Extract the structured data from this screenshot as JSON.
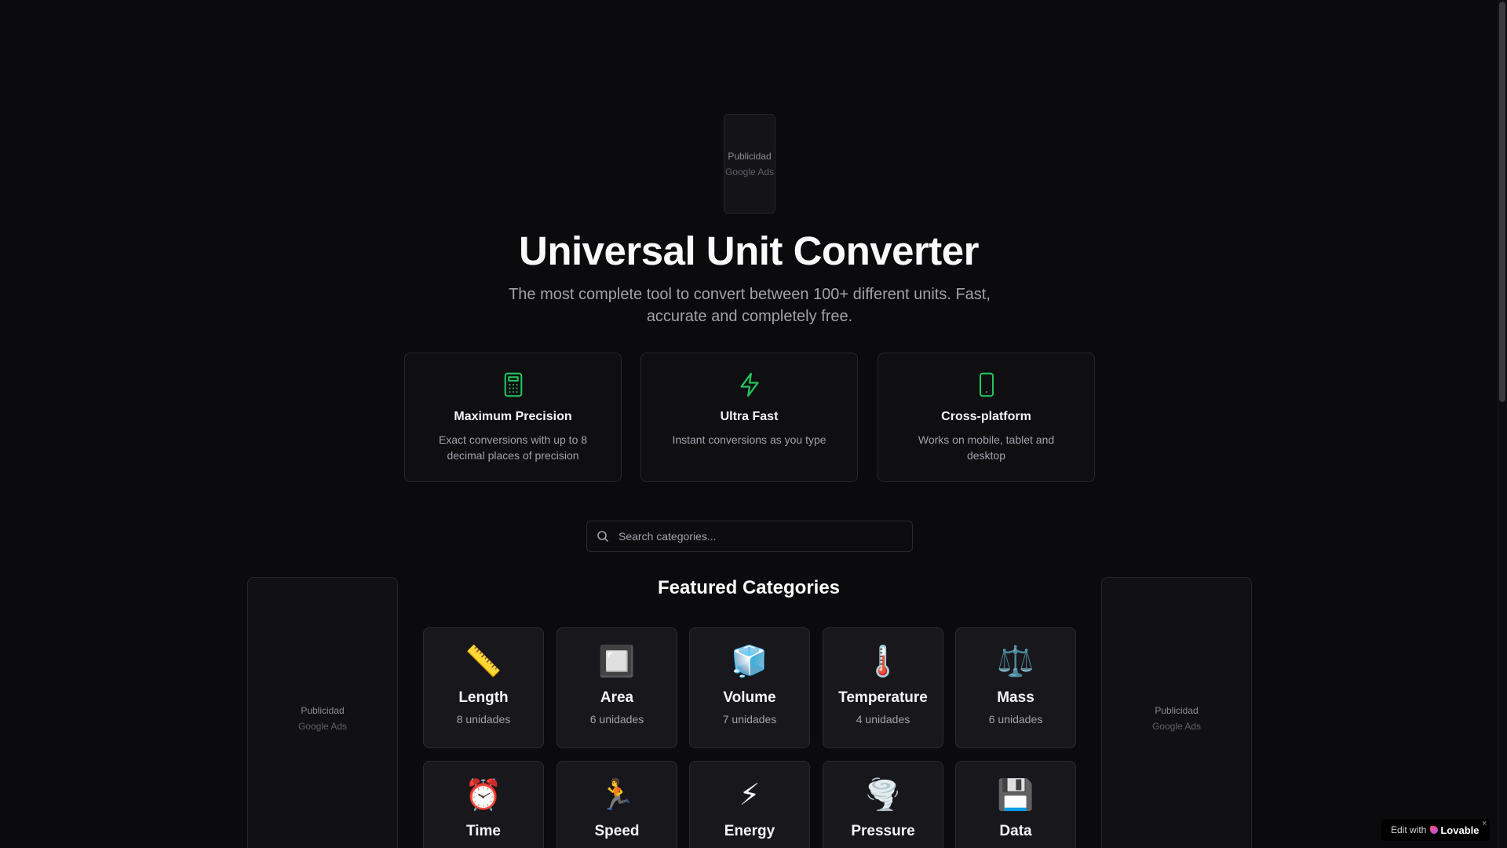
{
  "ads": {
    "label": "Publicidad",
    "provider": "Google Ads"
  },
  "hero": {
    "title": "Universal Unit Converter",
    "subtitle": "The most complete tool to convert between 100+ different units. Fast, accurate and completely free."
  },
  "features": [
    {
      "icon": "calculator-icon",
      "title": "Maximum Precision",
      "description": "Exact conversions with up to 8 decimal places of precision"
    },
    {
      "icon": "lightning-icon",
      "title": "Ultra Fast",
      "description": "Instant conversions as you type"
    },
    {
      "icon": "smartphone-icon",
      "title": "Cross-platform",
      "description": "Works on mobile, tablet and desktop"
    }
  ],
  "search": {
    "placeholder": "Search categories...",
    "value": ""
  },
  "featured": {
    "title": "Featured Categories",
    "categories": [
      {
        "emoji": "📏",
        "name": "Length",
        "count": "8 unidades"
      },
      {
        "emoji": "🔲",
        "name": "Area",
        "count": "6 unidades"
      },
      {
        "emoji": "🧊",
        "name": "Volume",
        "count": "7 unidades"
      },
      {
        "emoji": "🌡️",
        "name": "Temperature",
        "count": "4 unidades"
      },
      {
        "emoji": "⚖️",
        "name": "Mass",
        "count": "6 unidades"
      },
      {
        "emoji": "⏰",
        "name": "Time"
      },
      {
        "emoji": "🏃",
        "name": "Speed"
      },
      {
        "emoji": "⚡",
        "name": "Energy"
      },
      {
        "emoji": "🌪️",
        "name": "Pressure"
      },
      {
        "emoji": "💾",
        "name": "Data"
      }
    ]
  },
  "badge": {
    "prefix": "Edit with",
    "brand": "Lovable",
    "close": "×"
  },
  "colors": {
    "background": "#0b0b0d",
    "accent": "#22c55e",
    "card": "#18181c"
  }
}
